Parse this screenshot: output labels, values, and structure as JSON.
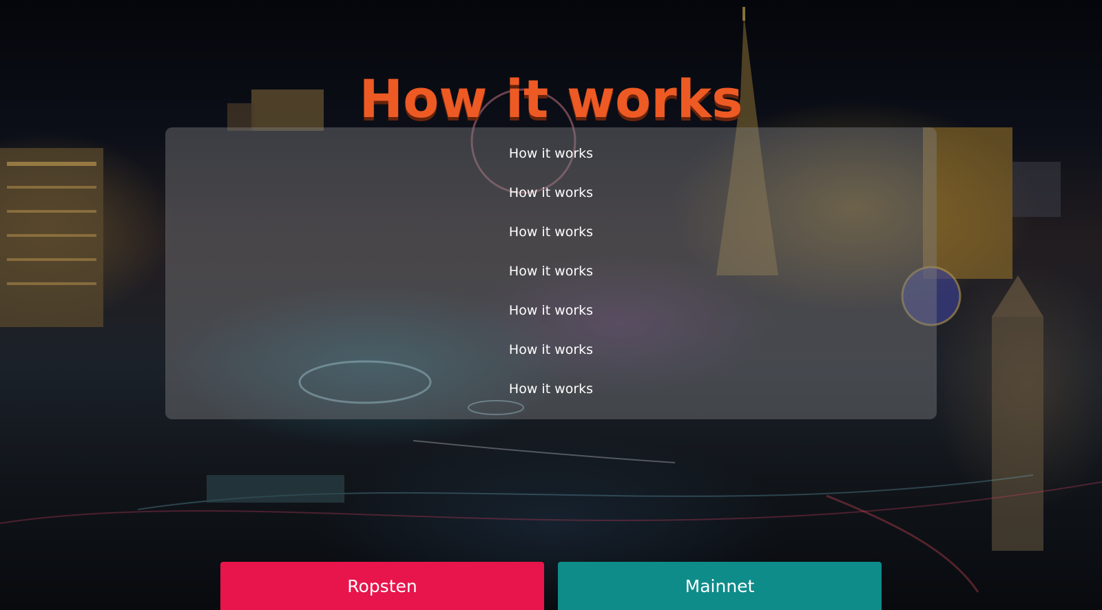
{
  "header": {
    "title": "How it works"
  },
  "steps": [
    "How it works",
    "How it works",
    "How it works",
    "How it works",
    "How it works",
    "How it works",
    "How it works"
  ],
  "buttons": {
    "ropsten": "Ropsten",
    "mainnet": "Mainnet"
  },
  "colors": {
    "title": "#ee5a24",
    "ropsten_button": "#e8154c",
    "mainnet_button": "#0e8c8a",
    "panel_overlay": "rgba(128,128,132,0.42)"
  }
}
